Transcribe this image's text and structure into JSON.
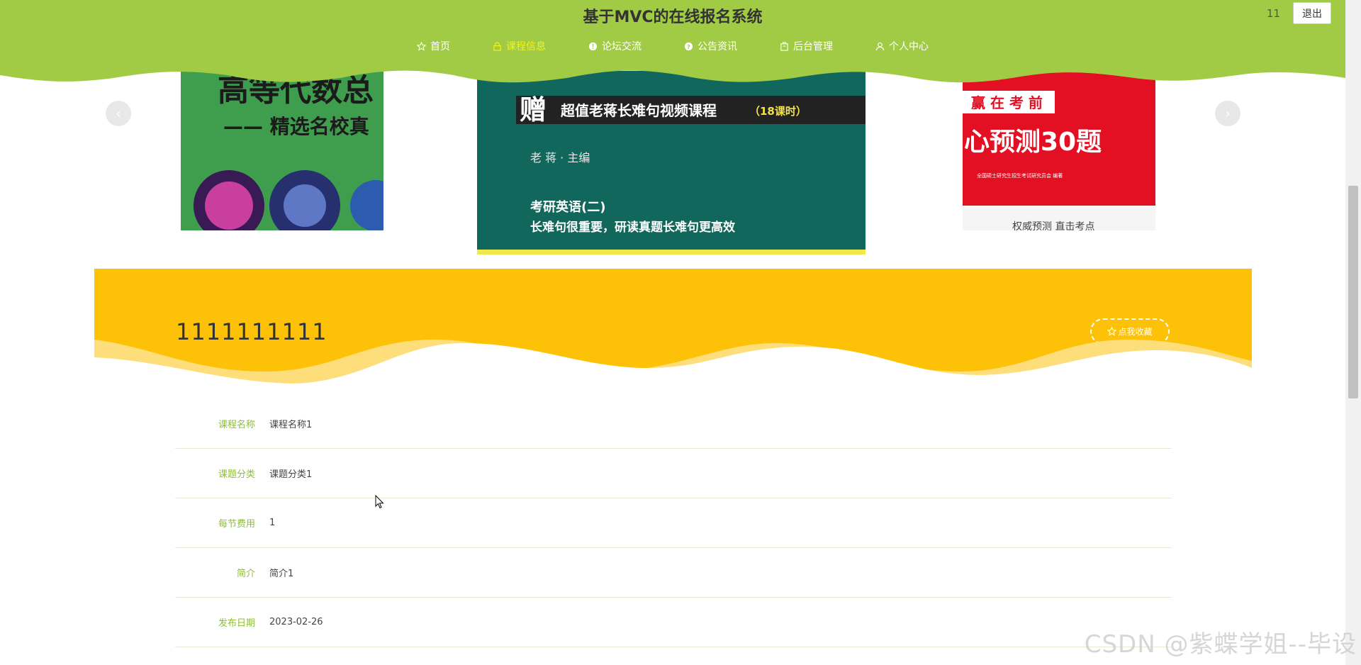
{
  "header": {
    "title": "基于MVC的在线报名系统",
    "username": "11",
    "logout_label": "退出",
    "nav": [
      {
        "label": "首页",
        "icon": "star-icon"
      },
      {
        "label": "课程信息",
        "icon": "lock-icon",
        "active": true
      },
      {
        "label": "论坛交流",
        "icon": "info-icon"
      },
      {
        "label": "公告资讯",
        "icon": "help-icon"
      },
      {
        "label": "后台管理",
        "icon": "building-icon"
      },
      {
        "label": "个人中心",
        "icon": "user-icon"
      }
    ],
    "bg_color": "#a2cb45"
  },
  "carousel": {
    "prev_arrow": "‹",
    "next_arrow": "›",
    "slides": [
      {
        "line1": "高等代数总",
        "line2": "—— 精选名校真"
      },
      {
        "banner_prefix": "赠",
        "banner": "超值老蒋长难句视频课程",
        "badge": "（18课时）",
        "author": "老 蒋 · 主编",
        "line1": "考研英语(二)",
        "line2": "长难句很重要，研读真题长难句更高效"
      },
      {
        "line0": "赢 在 考 前",
        "line1": "心预测30题",
        "small": "全国硕士研究生招生考试研究员会 编著",
        "line2": "权威预测    直击考点"
      }
    ]
  },
  "detail": {
    "title": "1111111111",
    "favorite_label": "点我收藏",
    "banner_color": "#fdc107"
  },
  "info_rows": [
    {
      "label": "课程名称",
      "value": "课程名称1"
    },
    {
      "label": "课题分类",
      "value": "课题分类1"
    },
    {
      "label": "每节费用",
      "value": "1"
    },
    {
      "label": "简介",
      "value": "简介1"
    },
    {
      "label": "发布日期",
      "value": "2023-02-26"
    }
  ],
  "watermark": "CSDN @紫蝶学姐--毕设"
}
